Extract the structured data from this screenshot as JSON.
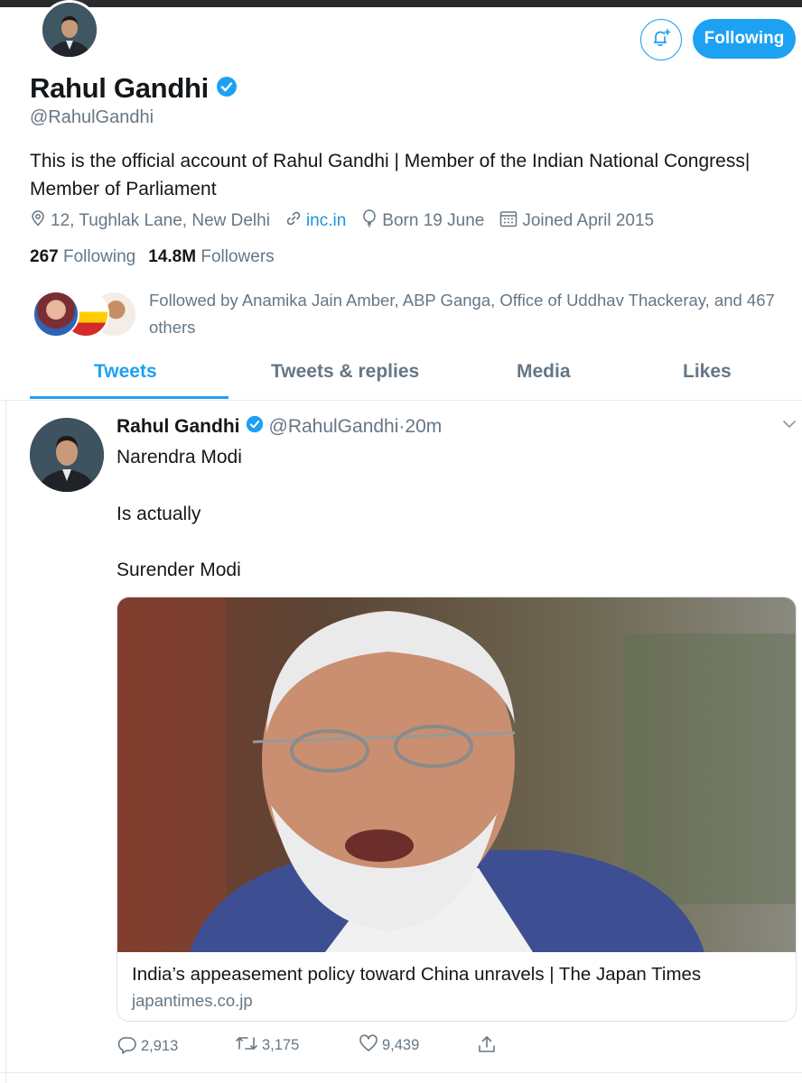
{
  "profile": {
    "name": "Rahul Gandhi",
    "handle": "@RahulGandhi",
    "bio": "This is the official account of Rahul Gandhi | Member of the Indian National Congress| Member of Parliament",
    "location": "12, Tughlak Lane, New Delhi",
    "website": "inc.in",
    "birthday": "Born 19 June",
    "joined": "Joined April 2015",
    "following_count": "267",
    "following_label": "Following",
    "followers_count": "14.8M",
    "followers_label": "Followers",
    "followed_by": "Followed by Anamika Jain Amber, ABP Ganga, Office of Uddhav Thackeray, and 467 others",
    "follow_button_label": "Following"
  },
  "tabs": [
    {
      "label": "Tweets",
      "active": true
    },
    {
      "label": "Tweets & replies",
      "active": false
    },
    {
      "label": "Media",
      "active": false
    },
    {
      "label": "Likes",
      "active": false
    }
  ],
  "tweet": {
    "author": "Rahul Gandhi",
    "handle": "@RahulGandhi",
    "time": "·20m",
    "lines": [
      "Narendra Modi",
      "Is actually",
      "Surender Modi"
    ],
    "card": {
      "title": "India’s appeasement policy toward China unravels | The Japan Times",
      "domain": "japantimes.co.jp"
    },
    "actions": {
      "replies": "2,913",
      "retweets": "3,175",
      "likes": "9,439"
    }
  },
  "colors": {
    "accent": "#1da1f2",
    "secondary_text": "#657786",
    "primary_text": "#14171a"
  },
  "icons": [
    "bell-plus-icon",
    "verified-badge-icon",
    "location-icon",
    "link-icon",
    "balloon-icon",
    "calendar-icon",
    "chevron-down-icon",
    "reply-icon",
    "retweet-icon",
    "heart-icon",
    "share-icon"
  ]
}
